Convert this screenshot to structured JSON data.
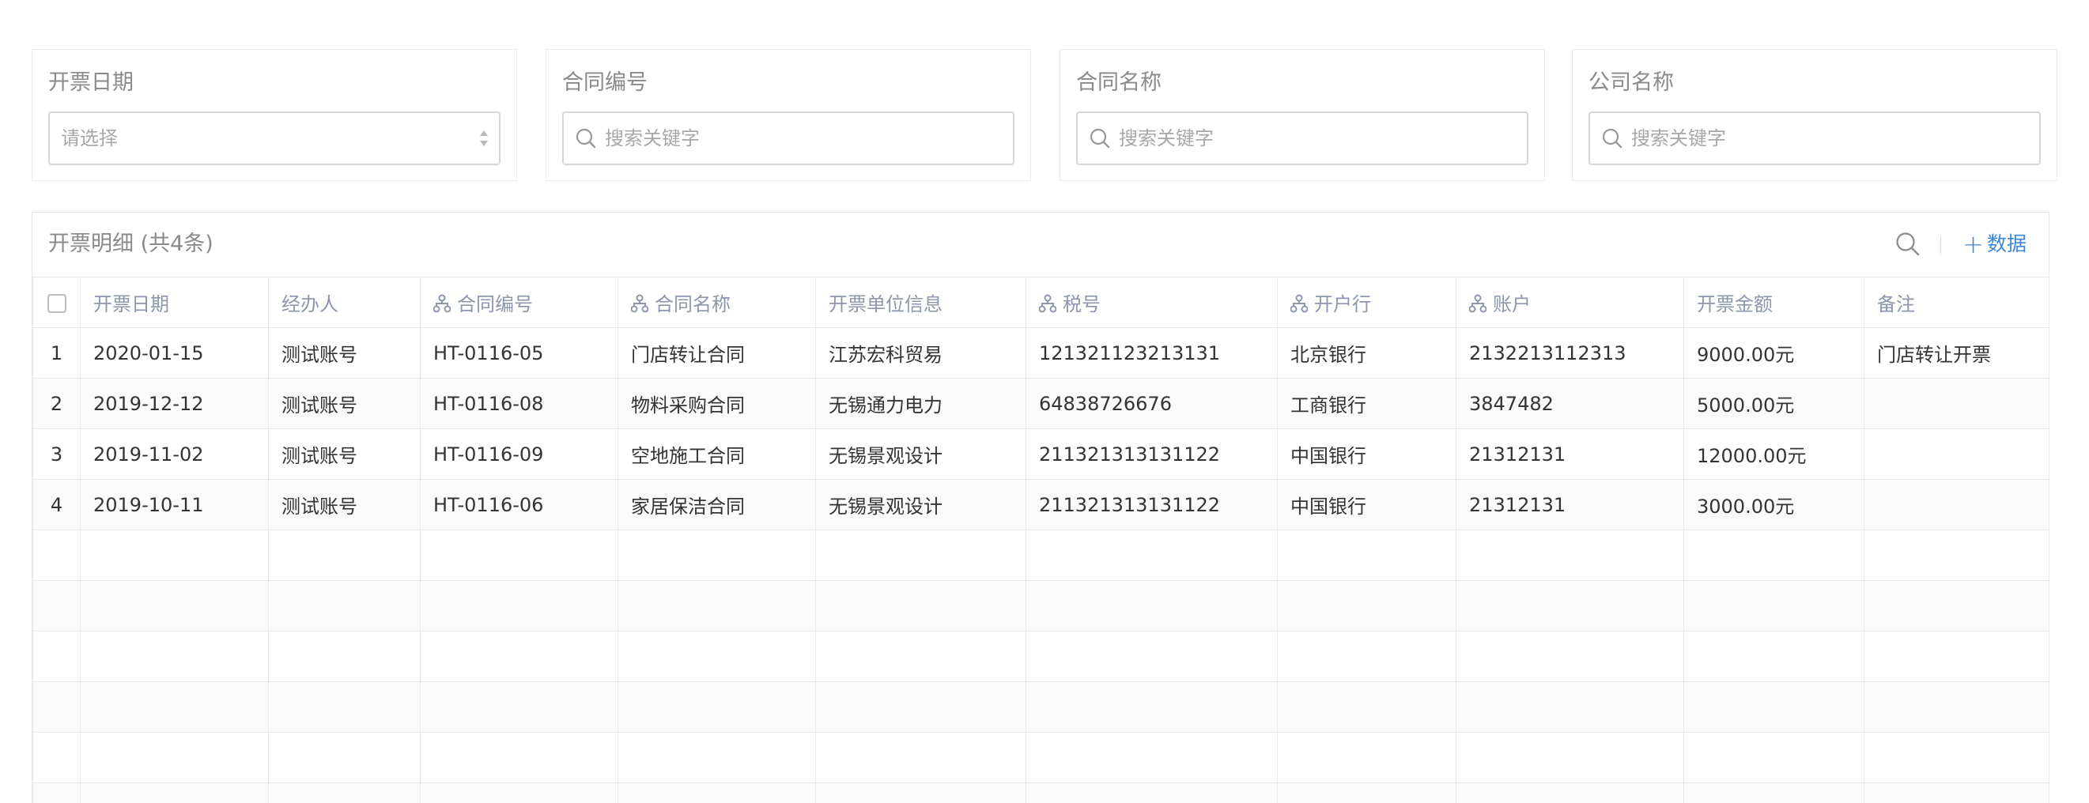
{
  "filters": [
    {
      "label": "开票日期",
      "type": "select",
      "placeholder": "请选择"
    },
    {
      "label": "合同编号",
      "type": "search",
      "placeholder": "搜索关键字"
    },
    {
      "label": "合同名称",
      "type": "search",
      "placeholder": "搜索关键字"
    },
    {
      "label": "公司名称",
      "type": "search",
      "placeholder": "搜索关键字"
    }
  ],
  "panel": {
    "title": "开票明细 (共4条)",
    "add_label": "数据",
    "icons": {
      "search": "search-icon",
      "add": "plus-icon",
      "linked_field": "tree-icon"
    }
  },
  "table": {
    "columns": [
      "开票日期",
      "经办人",
      "合同编号",
      "合同名称",
      "开票单位信息",
      "税号",
      "开户行",
      "账户",
      "开票金额",
      "备注"
    ],
    "rows": [
      {
        "index": "1",
        "cells": [
          "2020-01-15",
          "测试账号",
          "HT-0116-05",
          "门店转让合同",
          "江苏宏科贸易",
          "121321123213131",
          "北京银行",
          "2132213112313",
          "9000.00元",
          "门店转让开票"
        ]
      },
      {
        "index": "2",
        "cells": [
          "2019-12-12",
          "测试账号",
          "HT-0116-08",
          "物料采购合同",
          "无锡通力电力",
          "64838726676",
          "工商银行",
          "3847482",
          "5000.00元",
          ""
        ]
      },
      {
        "index": "3",
        "cells": [
          "2019-11-02",
          "测试账号",
          "HT-0116-09",
          "空地施工合同",
          "无锡景观设计",
          "211321313131122",
          "中国银行",
          "21312131",
          "12000.00元",
          ""
        ]
      },
      {
        "index": "4",
        "cells": [
          "2019-10-11",
          "测试账号",
          "HT-0116-06",
          "家居保洁合同",
          "无锡景观设计",
          "211321313131122",
          "中国银行",
          "21312131",
          "3000.00元",
          ""
        ]
      }
    ],
    "empty_rows": 6
  }
}
